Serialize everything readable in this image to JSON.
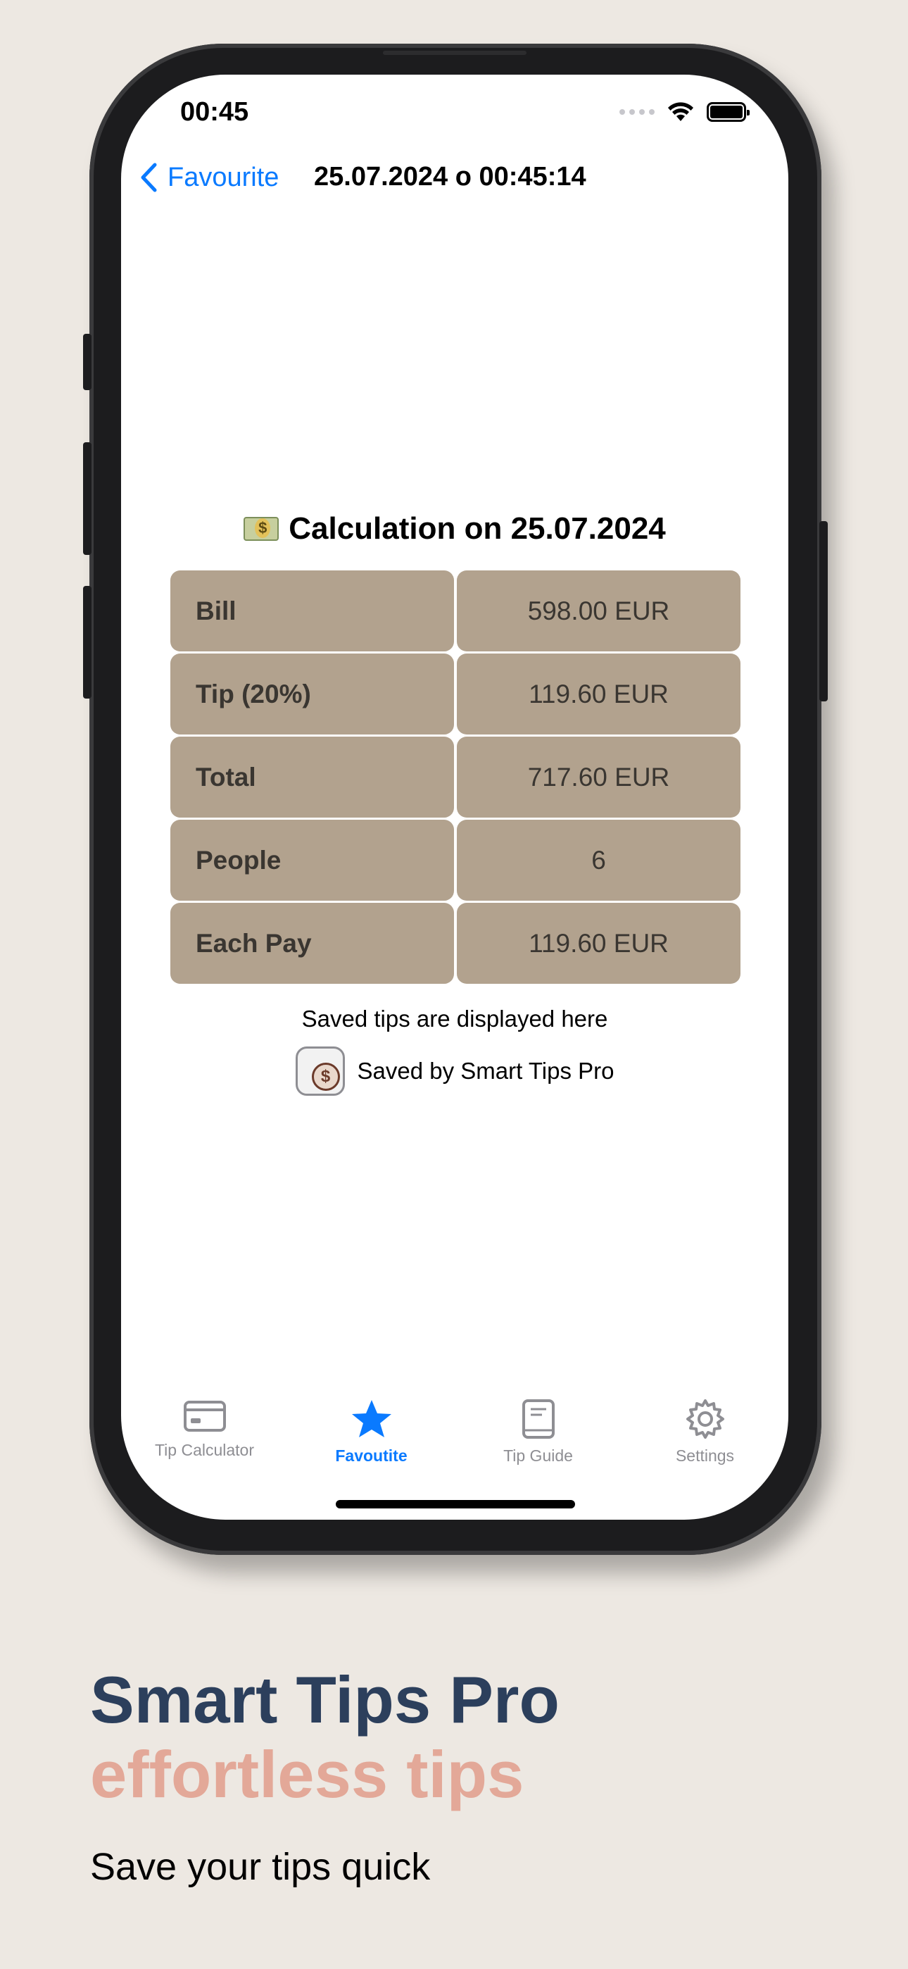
{
  "status_bar": {
    "time": "00:45"
  },
  "nav": {
    "back_label": "Favourite",
    "title": "25.07.2024 o 00:45:14"
  },
  "calculation": {
    "heading": "Calculation on 25.07.2024",
    "rows": [
      {
        "label": "Bill",
        "value": "598.00 EUR"
      },
      {
        "label": "Tip (20%)",
        "value": "119.60 EUR"
      },
      {
        "label": "Total",
        "value": "717.60 EUR"
      },
      {
        "label": "People",
        "value": "6"
      },
      {
        "label": "Each Pay",
        "value": "119.60 EUR"
      }
    ]
  },
  "saved_note": "Saved tips are displayed here",
  "saved_by": "Saved by Smart Tips Pro",
  "tabs": [
    {
      "label": "Tip Calculator",
      "icon": "card-icon"
    },
    {
      "label": "Favoutite",
      "icon": "star-icon",
      "active": true
    },
    {
      "label": "Tip Guide",
      "icon": "book-icon"
    },
    {
      "label": "Settings",
      "icon": "gear-icon"
    }
  ],
  "promo": {
    "title": "Smart Tips Pro",
    "subtitle": "effortless tips",
    "tagline": "Save your tips quick"
  },
  "colors": {
    "accent": "#0a7aff",
    "table_cell": "#b2a28e",
    "promo_title": "#2c3f5c",
    "promo_subtitle": "#e3a898",
    "background": "#ede8e2"
  }
}
